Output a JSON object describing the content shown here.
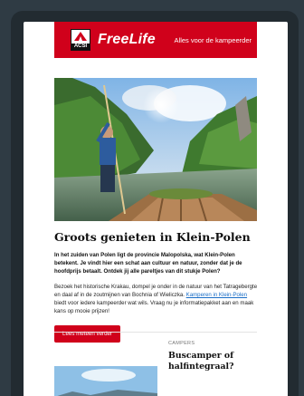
{
  "header": {
    "logo_text": "ACSI",
    "brand": "FreeLife",
    "tagline": "Alles voor de kampeerder",
    "color": "#d0011b"
  },
  "article": {
    "title": "Groots genieten in Klein-Polen",
    "intro": "In het zuiden van Polen ligt de provincie Malopolska, wat Klein-Polen betekent. Je vindt hier een schat aan cultuur en natuur, zonder dat je de hoofdprijs betaalt. Ontdek jij alle pareltjes van dit stukje Polen?",
    "body_before_link": "Bezoek het historische Krakau, dompel je onder in de natuur van het Tatragebergte en daal af in de zoutmijnen van Bochnia of Wieliczka. ",
    "link_text": "Kamperen in Klein-Polen",
    "body_after_link": " biedt voor iedere kampeerder wat wils. Vraag nu je informatiepakket aan en maak kans op mooie prijzen!",
    "cta_label": "Lees meteen verder"
  },
  "teaser": {
    "category": "CAMPERS",
    "title": "Buscamper of halfintegraal?"
  },
  "icons": {
    "logo": "tent-icon"
  }
}
